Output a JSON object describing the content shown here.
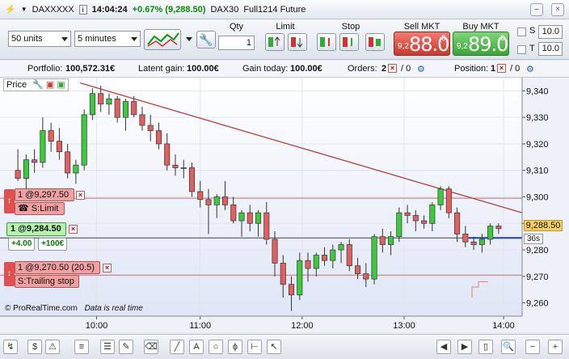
{
  "titlebar": {
    "symbol": "DAXXXXX",
    "time": "14:04:24",
    "change": "+0.67% (9,288.50)",
    "instrument": "DAX30",
    "contract": "Full1214 Future"
  },
  "toolbar": {
    "units_value": "50 units",
    "timeframe_value": "5 minutes",
    "qty_label": "Qty",
    "qty_value": "1",
    "limit_label": "Limit",
    "stop_label": "Stop",
    "sell_label": "Sell MKT",
    "sell_small": "9,2",
    "sell_big": "88.0",
    "sell_sup": "0",
    "buy_label": "Buy MKT",
    "buy_small": "9,2",
    "buy_big": "89.0",
    "buy_sup": "0",
    "s_label": "S",
    "s_value": "10.0",
    "t_label": "T",
    "t_value": "10.0"
  },
  "infobar": {
    "portfolio_label": "Portfolio:",
    "portfolio_value": "100,572.31€",
    "latent_label": "Latent gain:",
    "latent_value": "100.00€",
    "today_label": "Gain today:",
    "today_value": "100.00€",
    "orders_label": "Orders:",
    "orders_count": "2",
    "orders_sep": "/ 0",
    "position_label": "Position:",
    "position_count": "1",
    "position_sep": "/ 0"
  },
  "chart_data": {
    "type": "candlestick",
    "title": "",
    "price_label": "Price",
    "y_ticks": [
      "9,340",
      "9,330",
      "9,320",
      "9,310",
      "9,300",
      "9,290",
      "9,280",
      "9,270",
      "9,260"
    ],
    "ylim": [
      9255,
      9345
    ],
    "x_ticks": [
      "10:00",
      "11:00",
      "12:00",
      "13:00",
      "14:00"
    ],
    "current_price": "9,288.50",
    "countdown": "36s",
    "watermark": "© ProRealTime.com",
    "realtime_note": "Data is real time",
    "candles": [
      {
        "o": 9310,
        "h": 9318,
        "l": 9306,
        "c": 9307
      },
      {
        "o": 9307,
        "h": 9316,
        "l": 9303,
        "c": 9314
      },
      {
        "o": 9314,
        "h": 9318,
        "l": 9309,
        "c": 9313
      },
      {
        "o": 9313,
        "h": 9330,
        "l": 9311,
        "c": 9325
      },
      {
        "o": 9325,
        "h": 9328,
        "l": 9317,
        "c": 9321
      },
      {
        "o": 9321,
        "h": 9326,
        "l": 9314,
        "c": 9317
      },
      {
        "o": 9317,
        "h": 9320,
        "l": 9307,
        "c": 9309
      },
      {
        "o": 9309,
        "h": 9314,
        "l": 9305,
        "c": 9312
      },
      {
        "o": 9312,
        "h": 9333,
        "l": 9310,
        "c": 9331
      },
      {
        "o": 9331,
        "h": 9341,
        "l": 9329,
        "c": 9339
      },
      {
        "o": 9339,
        "h": 9342,
        "l": 9332,
        "c": 9335
      },
      {
        "o": 9335,
        "h": 9339,
        "l": 9331,
        "c": 9337
      },
      {
        "o": 9337,
        "h": 9338,
        "l": 9328,
        "c": 9330
      },
      {
        "o": 9330,
        "h": 9337,
        "l": 9325,
        "c": 9336
      },
      {
        "o": 9336,
        "h": 9338,
        "l": 9330,
        "c": 9331
      },
      {
        "o": 9331,
        "h": 9334,
        "l": 9325,
        "c": 9327
      },
      {
        "o": 9327,
        "h": 9331,
        "l": 9321,
        "c": 9325
      },
      {
        "o": 9325,
        "h": 9328,
        "l": 9318,
        "c": 9320
      },
      {
        "o": 9320,
        "h": 9324,
        "l": 9310,
        "c": 9312
      },
      {
        "o": 9312,
        "h": 9316,
        "l": 9308,
        "c": 9311
      },
      {
        "o": 9311,
        "h": 9314,
        "l": 9307,
        "c": 9311
      },
      {
        "o": 9311,
        "h": 9313,
        "l": 9300,
        "c": 9302
      },
      {
        "o": 9302,
        "h": 9306,
        "l": 9296,
        "c": 9299
      },
      {
        "o": 9299,
        "h": 9303,
        "l": 9286,
        "c": 9297
      },
      {
        "o": 9297,
        "h": 9301,
        "l": 9292,
        "c": 9300
      },
      {
        "o": 9300,
        "h": 9306,
        "l": 9295,
        "c": 9297
      },
      {
        "o": 9297,
        "h": 9300,
        "l": 9290,
        "c": 9291
      },
      {
        "o": 9291,
        "h": 9295,
        "l": 9285,
        "c": 9294
      },
      {
        "o": 9294,
        "h": 9297,
        "l": 9287,
        "c": 9290
      },
      {
        "o": 9290,
        "h": 9295,
        "l": 9285,
        "c": 9294
      },
      {
        "o": 9294,
        "h": 9298,
        "l": 9282,
        "c": 9284
      },
      {
        "o": 9284,
        "h": 9287,
        "l": 9270,
        "c": 9275
      },
      {
        "o": 9275,
        "h": 9278,
        "l": 9262,
        "c": 9267
      },
      {
        "o": 9267,
        "h": 9270,
        "l": 9257,
        "c": 9263
      },
      {
        "o": 9263,
        "h": 9279,
        "l": 9261,
        "c": 9276
      },
      {
        "o": 9276,
        "h": 9279,
        "l": 9268,
        "c": 9273
      },
      {
        "o": 9273,
        "h": 9279,
        "l": 9270,
        "c": 9278
      },
      {
        "o": 9278,
        "h": 9281,
        "l": 9274,
        "c": 9276
      },
      {
        "o": 9276,
        "h": 9282,
        "l": 9273,
        "c": 9280
      },
      {
        "o": 9280,
        "h": 9283,
        "l": 9275,
        "c": 9282
      },
      {
        "o": 9282,
        "h": 9284,
        "l": 9272,
        "c": 9274
      },
      {
        "o": 9274,
        "h": 9277,
        "l": 9269,
        "c": 9271
      },
      {
        "o": 9271,
        "h": 9275,
        "l": 9266,
        "c": 9269
      },
      {
        "o": 9269,
        "h": 9286,
        "l": 9267,
        "c": 9285
      },
      {
        "o": 9285,
        "h": 9288,
        "l": 9279,
        "c": 9282
      },
      {
        "o": 9282,
        "h": 9287,
        "l": 9278,
        "c": 9285
      },
      {
        "o": 9285,
        "h": 9296,
        "l": 9283,
        "c": 9294
      },
      {
        "o": 9294,
        "h": 9297,
        "l": 9290,
        "c": 9293
      },
      {
        "o": 9293,
        "h": 9295,
        "l": 9287,
        "c": 9291
      },
      {
        "o": 9291,
        "h": 9293,
        "l": 9288,
        "c": 9290
      },
      {
        "o": 9290,
        "h": 9298,
        "l": 9287,
        "c": 9297
      },
      {
        "o": 9297,
        "h": 9304,
        "l": 9295,
        "c": 9303
      },
      {
        "o": 9303,
        "h": 9304,
        "l": 9292,
        "c": 9294
      },
      {
        "o": 9294,
        "h": 9296,
        "l": 9283,
        "c": 9286
      },
      {
        "o": 9286,
        "h": 9289,
        "l": 9281,
        "c": 9283
      },
      {
        "o": 9283,
        "h": 9285,
        "l": 9280,
        "c": 9282
      },
      {
        "o": 9282,
        "h": 9286,
        "l": 9279,
        "c": 9284
      },
      {
        "o": 9284,
        "h": 9290,
        "l": 9282,
        "c": 9289
      },
      {
        "o": 9289,
        "h": 9290,
        "l": 9286,
        "c": 9288
      }
    ],
    "trendline": {
      "from": {
        "i": 7.5,
        "price": 9343
      },
      "to": {
        "i": 61.5,
        "price": 9294
      }
    },
    "hlines": [
      {
        "price": 9299.5,
        "color": "#c07070"
      },
      {
        "price": 9284.5,
        "color": "#444444"
      },
      {
        "price": 9270.5,
        "color": "#c07070"
      }
    ],
    "orders": [
      {
        "label": "1 @9,297.50",
        "sub": "S:Limit",
        "price": 9299.5
      },
      {
        "label": "1 @9,284.50",
        "chip1": "+4.00",
        "chip2": "+100€",
        "price": 9284.5
      },
      {
        "label": "1 @9,270.50 (20.5)",
        "sub": "S:Trailing stop",
        "price": 9270.5
      }
    ]
  }
}
